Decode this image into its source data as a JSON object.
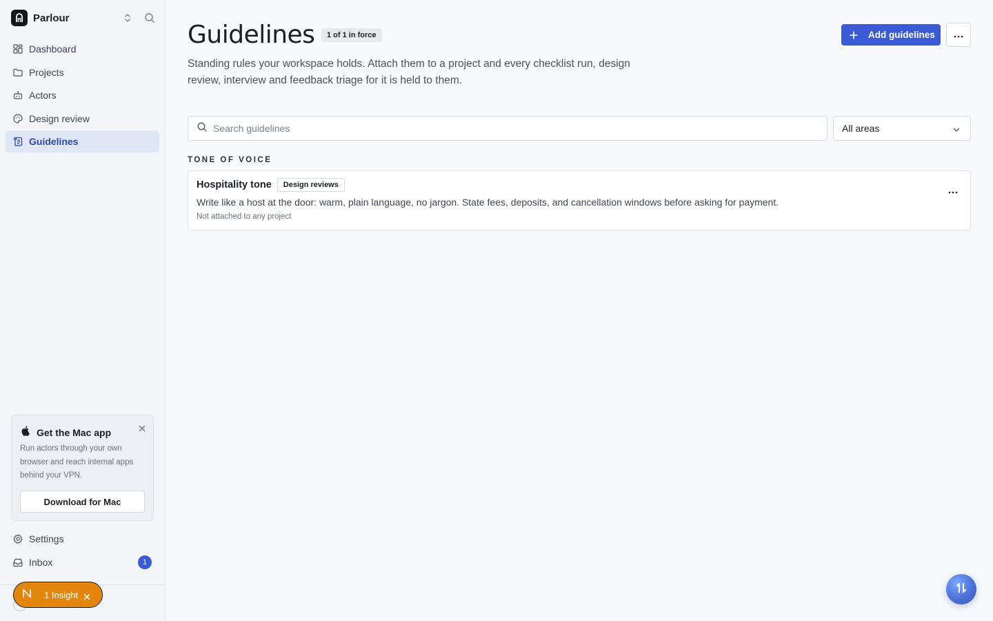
{
  "workspace": {
    "name": "Parlour"
  },
  "sidebar": {
    "items": [
      {
        "label": "Dashboard"
      },
      {
        "label": "Projects"
      },
      {
        "label": "Actors"
      },
      {
        "label": "Design review"
      },
      {
        "label": "Guidelines"
      }
    ],
    "active_item": "Guidelines",
    "promo": {
      "title": "Get the Mac app",
      "text": "Run actors through your own browser and reach internal apps behind your VPN.",
      "button": "Download for Mac"
    },
    "bottom_items": [
      {
        "label": "Settings"
      },
      {
        "label": "Inbox",
        "count": "1"
      }
    ],
    "insight": {
      "label": "1 Insight"
    }
  },
  "page": {
    "title": "Guidelines",
    "badge": "1 of 1 in force",
    "subtitle": "Standing rules your workspace holds. Attach them to a project and every checklist run, design review, interview and feedback triage for it is held to them.",
    "add_button": "Add guidelines"
  },
  "search": {
    "placeholder": "Search guidelines",
    "value": ""
  },
  "filter": {
    "selected": "All areas"
  },
  "sections": [
    {
      "label": "TONE OF VOICE",
      "guidelines": [
        {
          "title": "Hospitality tone",
          "tag": "Design reviews",
          "description": "Write like a host at the door: warm, plain language, no jargon. State fees, deposits, and cancellation windows before asking for payment.",
          "meta": "Not attached to any project"
        }
      ]
    }
  ],
  "colors": {
    "accent": "#3b5bd6",
    "active_bg": "#dfe6f6",
    "insight": "#e3860b",
    "background": "#f8f9fc",
    "sidebar_bg": "#f3f5f9"
  },
  "icons": {
    "workspace": "parlour-logo-icon",
    "switcher": "chevron-updown-icon",
    "search": "search-icon",
    "dashboard": "grid-icon",
    "projects": "folder-icon",
    "actors": "robot-icon",
    "design_review": "palette-icon",
    "guidelines": "scroll-icon",
    "settings": "gear-icon",
    "inbox": "inbox-icon",
    "apple": "apple-icon",
    "close": "close-icon",
    "plus": "plus-icon",
    "more": "more-icon",
    "chevron": "chevron-down-icon",
    "assistant": "assistant-icon"
  }
}
